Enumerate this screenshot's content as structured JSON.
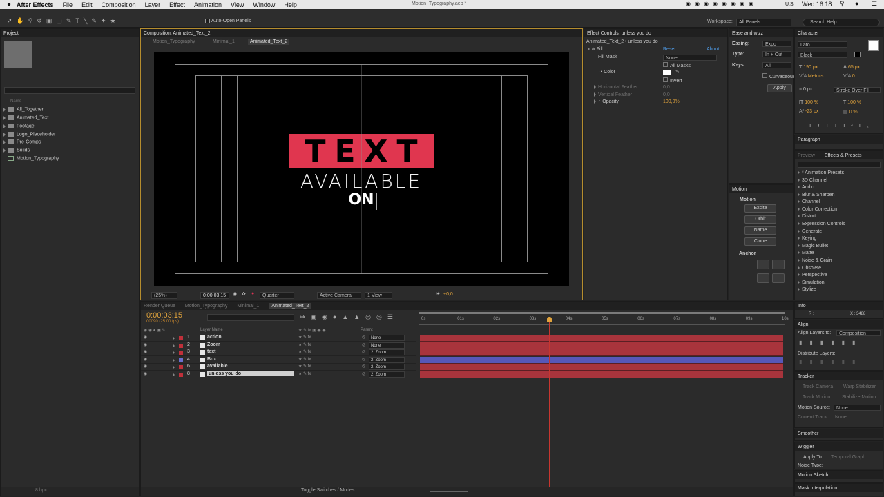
{
  "menubar": {
    "app": "After Effects",
    "items": [
      "File",
      "Edit",
      "Composition",
      "Layer",
      "Effect",
      "Animation",
      "View",
      "Window",
      "Help"
    ],
    "title": "Motion_Typography.aep *",
    "locale": "U.S.",
    "clock": "Wed 16:18"
  },
  "toolbar": {
    "auto_open": "Auto-Open Panels",
    "workspace_label": "Workspace:",
    "workspace_value": "All Panels",
    "search_help": "Search Help"
  },
  "project": {
    "tab": "Project",
    "col_name": "Name",
    "items": [
      "All_Together",
      "Animated_Text",
      "Footage",
      "Logo_Placeholder",
      "Pre-Comps",
      "Solids",
      "Motion_Typography"
    ],
    "bpc": "8 bpc"
  },
  "comp": {
    "tab": "Composition: Animated_Text_2",
    "subtabs": [
      "Motion_Typography",
      "Minimal_1",
      "Animated_Text_2"
    ],
    "line1": "TEXT",
    "line2": "AVAILABLE",
    "line3": "ON",
    "box_color": "#e0364f",
    "zoom": "(25%)",
    "time": "0:00:03:15",
    "res": "Quarter",
    "camera": "Active Camera",
    "view": "1 View",
    "exposure": "+0,0"
  },
  "effect": {
    "tab": "Effect Controls: unless you do",
    "path": "Animated_Text_2 • unless you do",
    "name": "Fill",
    "reset": "Reset",
    "about": "About",
    "fill_mask_label": "Fill Mask",
    "fill_mask_value": "None",
    "all_masks": "All Masks",
    "color_label": "Color",
    "invert": "Invert",
    "hfeather": "Horizontal Feather",
    "hfeather_v": "0,0",
    "vfeather": "Vertical Feather",
    "vfeather_v": "0,0",
    "opacity": "Opacity",
    "opacity_v": "100,0%"
  },
  "ease": {
    "tab": "Ease and wizz",
    "easing_l": "Easing:",
    "easing_v": "Expo",
    "type_l": "Type:",
    "type_v": "In + Out",
    "keys_l": "Keys:",
    "keys_v": "All",
    "curvaceous": "Curvaceous",
    "apply": "Apply"
  },
  "motion": {
    "tab": "Motion",
    "group": "Motion",
    "buttons": [
      "Excite",
      "Orbit",
      "Name",
      "Clone"
    ],
    "anchor": "Anchor"
  },
  "character": {
    "tab": "Character",
    "font": "Lato",
    "style": "Black",
    "size": "190 px",
    "leading": "65 px",
    "kerning": "Metrics",
    "tracking": "0",
    "stroke": "0 px",
    "stroke_type": "Stroke Over Fill",
    "vscale": "100 %",
    "hscale": "100 %",
    "baseline": "-23 px",
    "tsume": "0 %",
    "paragraph": "Paragraph"
  },
  "effects_presets": {
    "tabs": [
      "Preview",
      "Effects & Presets"
    ],
    "items": [
      "* Animation Presets",
      "3D Channel",
      "Audio",
      "Blur & Sharpen",
      "Channel",
      "Color Correction",
      "Distort",
      "Expression Controls",
      "Generate",
      "Keying",
      "Magic Bullet",
      "Matte",
      "Noise & Grain",
      "Obsolete",
      "Perspective",
      "Simulation",
      "Stylize"
    ]
  },
  "info": {
    "tab": "Info",
    "r": "R :",
    "x": "X : 3488"
  },
  "align": {
    "tab": "Align",
    "to_label": "Align Layers to:",
    "to_value": "Composition",
    "distribute": "Distribute Layers:"
  },
  "tracker": {
    "tab": "Tracker",
    "track_camera": "Track Camera",
    "warp": "Warp Stabilizer",
    "track_motion": "Track Motion",
    "stab_motion": "Stabilize Motion",
    "source_l": "Motion Source:",
    "source_v": "None",
    "current_l": "Current Track:",
    "current_v": "None"
  },
  "bottom_right": {
    "smoother": "Smoother",
    "wiggler": "Wiggler",
    "apply_to": "Apply To:",
    "apply_to_v": "Temporal Graph",
    "noise": "Noise Type:",
    "motion_sketch": "Motion Sketch",
    "mask_interp": "Mask Interpolation"
  },
  "timeline": {
    "tabs": [
      "Render Queue",
      "Motion_Typography",
      "Minimal_1",
      "Animated_Text_2"
    ],
    "time": "0:00:03:15",
    "frames": "00090 (25.00 fps)",
    "col_layer": "Layer Name",
    "col_parent": "Parent",
    "toggle": "Toggle Switches / Modes",
    "ruler": [
      "0s",
      "01s",
      "02s",
      "03s",
      "04s",
      "05s",
      "06s",
      "07s",
      "08s",
      "09s",
      "10s"
    ],
    "layers": [
      {
        "num": "1",
        "name": "action",
        "parent": "None",
        "label": "#c0303a",
        "bar": "#a8343c"
      },
      {
        "num": "2",
        "name": "Zoom",
        "parent": "None",
        "label": "#c0303a",
        "bar": "#a8343c"
      },
      {
        "num": "3",
        "name": "text",
        "parent": "2. Zoom",
        "label": "#c0303a",
        "bar": "#a8343c"
      },
      {
        "num": "4",
        "name": "Box",
        "parent": "2. Zoom",
        "label": "#6b6fd0",
        "bar": "#5757b8"
      },
      {
        "num": "6",
        "name": "available",
        "parent": "2. Zoom",
        "label": "#c0303a",
        "bar": "#a8343c"
      },
      {
        "num": "8",
        "name": "unless you do",
        "parent": "2. Zoom",
        "label": "#c0303a",
        "bar": "#a8343c"
      }
    ]
  }
}
